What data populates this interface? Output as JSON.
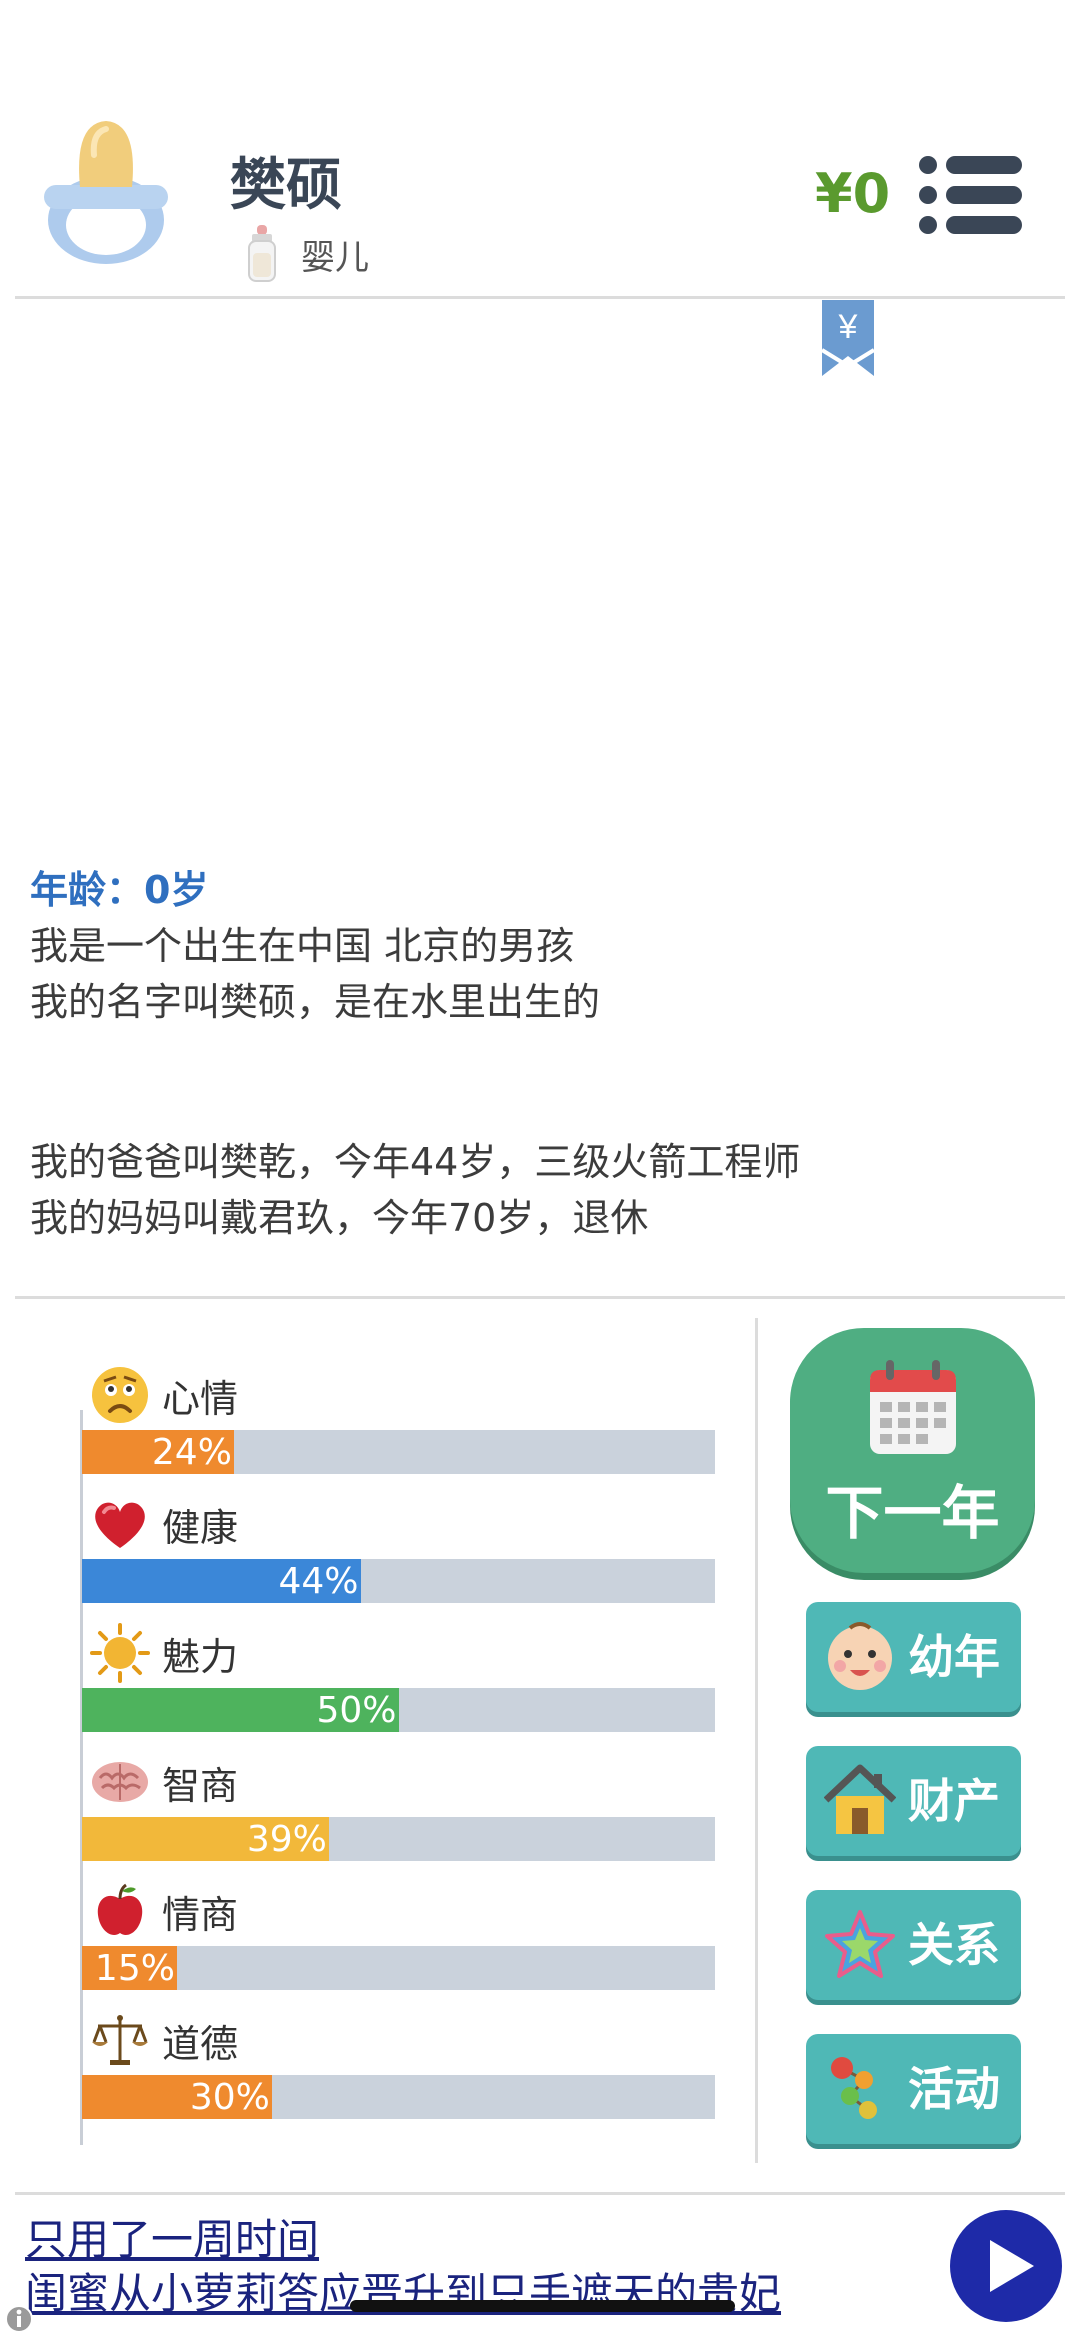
{
  "header": {
    "name": "樊硕",
    "stage": "婴儿",
    "money": "¥0",
    "bookmark_symbol": "¥"
  },
  "story": {
    "age": "年龄：0岁",
    "lines": [
      "我是一个出生在中国 北京的男孩",
      "我的名字叫樊硕，是在水里出生的",
      "我的爸爸叫樊乾，今年44岁，三级火箭工程师",
      "我的妈妈叫戴君玖，今年70岁，退休"
    ]
  },
  "stats": [
    {
      "label": "心情",
      "percent": 24,
      "text": "24%",
      "color": "#ef8a2e",
      "icon": "sad-face-icon"
    },
    {
      "label": "健康",
      "percent": 44,
      "text": "44%",
      "color": "#3b87d8",
      "icon": "heart-icon"
    },
    {
      "label": "魅力",
      "percent": 50,
      "text": "50%",
      "color": "#4eb35d",
      "icon": "sun-icon"
    },
    {
      "label": "智商",
      "percent": 39,
      "text": "39%",
      "color": "#f2b83a",
      "icon": "brain-icon"
    },
    {
      "label": "情商",
      "percent": 15,
      "text": "15%",
      "color": "#ef8a2e",
      "icon": "apple-icon"
    },
    {
      "label": "道德",
      "percent": 30,
      "text": "30%",
      "color": "#ef8a2e",
      "icon": "scales-icon"
    }
  ],
  "actions": {
    "next_year": "下一年",
    "childhood": "幼年",
    "assets": "财产",
    "relations": "关系",
    "activities": "活动"
  },
  "ad": {
    "line1": "只用了一周时间",
    "line2": "闺蜜从小萝莉答应晋升到只手遮天的贵妃"
  },
  "colors": {
    "accent_blue": "#2f6fbf",
    "money_green": "#5a9a2e",
    "next_year_green": "#4fae82",
    "side_button_teal": "#4fb8b6",
    "ad_link": "#1a237e"
  }
}
